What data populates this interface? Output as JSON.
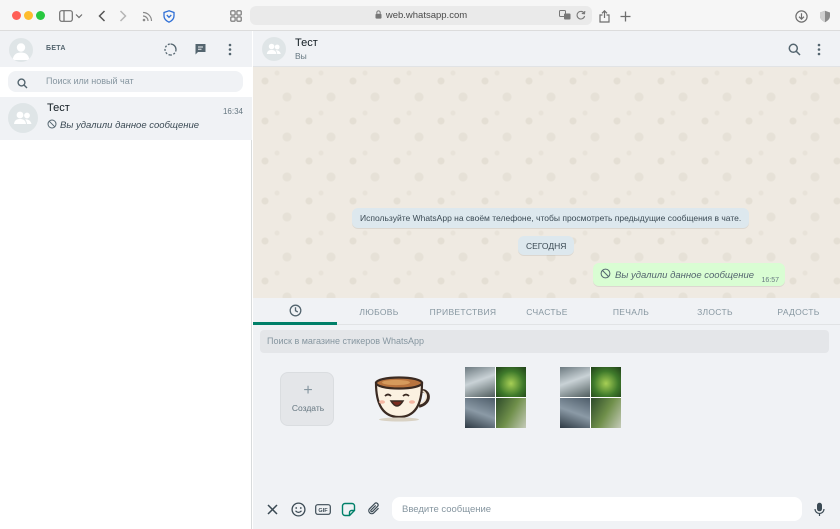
{
  "browser": {
    "url": "web.whatsapp.com",
    "colors": {
      "close": "#ff5f57",
      "minimize": "#febc2e",
      "maximize": "#28c840",
      "shield": "#2f6fd6"
    },
    "icons": [
      "sidebar-toggle-icon",
      "chevron-down-icon",
      "back-icon",
      "forward-icon",
      "rss-icon",
      "shield-icon",
      "tab-overview-icon",
      "lock-icon",
      "translate-icon",
      "reload-icon",
      "share-icon",
      "new-tab-icon",
      "downloads-icon",
      "shield-right-icon"
    ]
  },
  "sidebar": {
    "beta_label": "БЕТА",
    "header_icons": [
      "status-icon",
      "new-chat-icon",
      "menu-icon"
    ],
    "search_placeholder": "Поиск или новый чат",
    "chats": [
      {
        "name": "Тест",
        "time": "16:34",
        "preview": "Вы удалили данное сообщение"
      }
    ]
  },
  "conversation": {
    "title": "Тест",
    "subtitle": "Вы",
    "header_icons": [
      "search-icon",
      "menu-icon"
    ],
    "system_note": "Используйте WhatsApp на своём телефоне, чтобы просмотреть предыдущие сообщения в чате.",
    "date_label": "СЕГОДНЯ",
    "messages": [
      {
        "direction": "outgoing",
        "text": "Вы удалили данное сообщение",
        "time": "16:57"
      }
    ]
  },
  "sticker_panel": {
    "tabs": [
      "recent",
      "ЛЮБОВЬ",
      "ПРИВЕТСТВИЯ",
      "СЧАСТЬЕ",
      "ПЕЧАЛЬ",
      "ЗЛОСТЬ",
      "РАДОСТЬ"
    ],
    "active_tab": "recent",
    "search_placeholder": "Поиск в магазине стикеров WhatsApp",
    "create_label": "Создать",
    "stickers": [
      "coffee-cup-sticker",
      "photo-collage-sticker",
      "photo-collage-sticker"
    ]
  },
  "composer": {
    "placeholder": "Введите сообщение",
    "icons": [
      "close-icon",
      "emoji-icon",
      "gif-icon",
      "sticker-icon",
      "attach-icon",
      "mic-icon"
    ],
    "accent_color": "#008069"
  }
}
